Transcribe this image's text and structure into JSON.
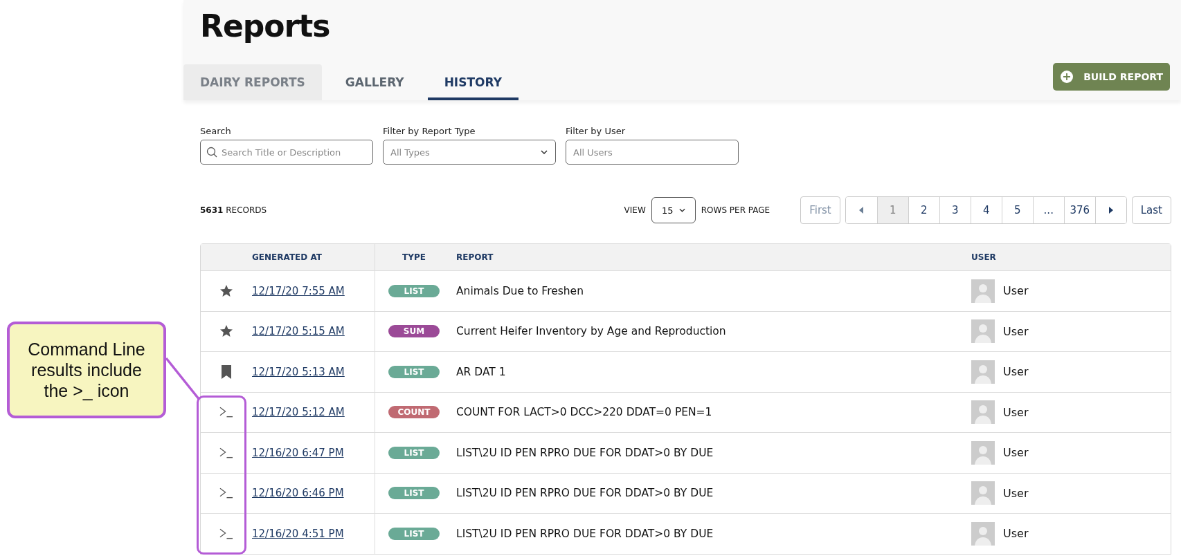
{
  "page": {
    "title": "Reports"
  },
  "tabs": [
    {
      "label": "DAIRY REPORTS",
      "selected": false,
      "shaded": true
    },
    {
      "label": "GALLERY",
      "selected": false,
      "shaded": false
    },
    {
      "label": "HISTORY",
      "selected": true,
      "shaded": false
    }
  ],
  "build_button": {
    "label": "BUILD REPORT"
  },
  "filters": [
    {
      "kind": "search",
      "label": "Search",
      "placeholder": "Search Title or Description"
    },
    {
      "kind": "select",
      "label": "Filter by Report Type",
      "placeholder": "All Types"
    },
    {
      "kind": "text",
      "label": "Filter by User",
      "placeholder": "All Users"
    }
  ],
  "records": "**5631** RECORDS",
  "view": {
    "label": "VIEW",
    "value": "15",
    "suffix": "ROWS PER PAGE"
  },
  "pagination": [
    {
      "kind": "first",
      "label": "First",
      "disabled": true,
      "selected": false
    },
    {
      "kind": "prev",
      "disabled": true,
      "selected": false
    },
    {
      "kind": "page",
      "label": "1",
      "disabled": false,
      "selected": true
    },
    {
      "kind": "page",
      "label": "2",
      "disabled": false,
      "selected": false
    },
    {
      "kind": "page",
      "label": "3",
      "disabled": false,
      "selected": false
    },
    {
      "kind": "page",
      "label": "4",
      "disabled": false,
      "selected": false
    },
    {
      "kind": "page",
      "label": "5",
      "disabled": false,
      "selected": false
    },
    {
      "kind": "page",
      "label": "...",
      "disabled": false,
      "selected": false
    },
    {
      "kind": "page",
      "label": "376",
      "disabled": false,
      "selected": false
    },
    {
      "kind": "next",
      "disabled": false,
      "selected": false
    },
    {
      "kind": "last",
      "label": "Last",
      "disabled": false,
      "selected": false
    }
  ],
  "table": {
    "columns": [
      "GENERATED AT",
      "TYPE",
      "REPORT",
      "USER"
    ],
    "rows": [
      {
        "kind": "star",
        "generated_at": "12/17/20 7:55 AM",
        "type": "LIST",
        "color": "#6aaa96",
        "report": "Animals Due to Freshen",
        "user": "User"
      },
      {
        "kind": "star",
        "generated_at": "12/17/20 5:15 AM",
        "type": "SUM",
        "color": "#9b4a97",
        "report": "Current Heifer Inventory by Age and Reproduction",
        "user": "User"
      },
      {
        "kind": "bookmark",
        "generated_at": "12/17/20 5:13 AM",
        "type": "LIST",
        "color": "#6aaa96",
        "report": "AR DAT 1",
        "user": "User"
      },
      {
        "kind": "terminal",
        "generated_at": "12/17/20 5:12 AM",
        "type": "COUNT",
        "color": "#c06a72",
        "report": "COUNT FOR LACT>0 DCC>220 DDAT=0 PEN=1",
        "user": "User"
      },
      {
        "kind": "terminal",
        "generated_at": "12/16/20 6:47 PM",
        "type": "LIST",
        "color": "#6aaa96",
        "report": "LIST\\2U ID PEN RPRO DUE FOR DDAT>0 BY DUE",
        "user": "User"
      },
      {
        "kind": "terminal",
        "generated_at": "12/16/20 6:46 PM",
        "type": "LIST",
        "color": "#6aaa96",
        "report": "LIST\\2U ID PEN RPRO DUE FOR DDAT>0 BY DUE",
        "user": "User"
      },
      {
        "kind": "terminal",
        "generated_at": "12/16/20 4:51 PM",
        "type": "LIST",
        "color": "#6aaa96",
        "report": "LIST\\2U ID PEN RPRO DUE FOR DDAT>0 BY DUE",
        "user": "User"
      }
    ]
  },
  "callout": {
    "text": "Command Line results include the >_ icon"
  }
}
